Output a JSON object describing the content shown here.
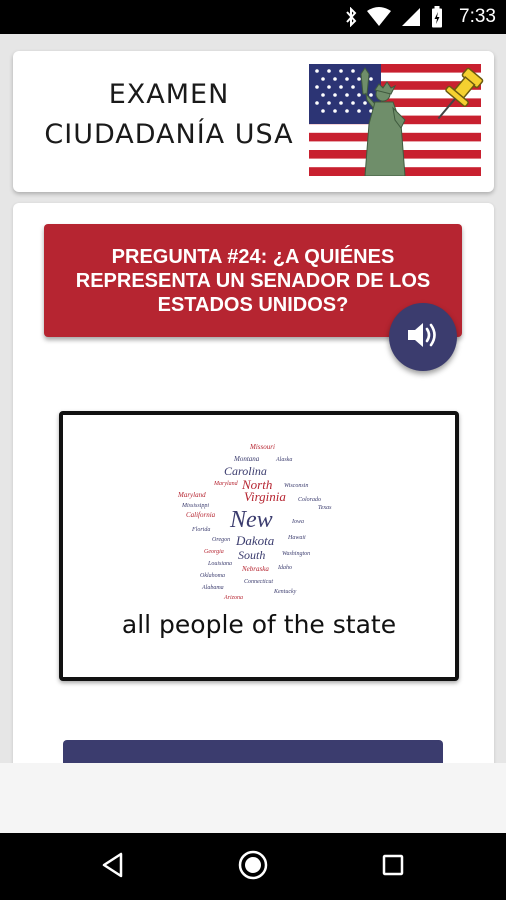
{
  "status_bar": {
    "time": "7:33",
    "icons": [
      "bluetooth-icon",
      "wifi-icon",
      "signal-icon",
      "battery-icon"
    ]
  },
  "header": {
    "title_line1": "EXAMEN",
    "title_line2": "CIUDADANÍA USA",
    "logo": "us-flag-statue-of-liberty-pin-logo"
  },
  "question": {
    "text": "PREGUNTA #24: ¿A QUIÉNES REPRESENTA UN SENADOR DE LOS ESTADOS UNIDOS?",
    "audio_icon": "speaker-icon"
  },
  "answer": {
    "image": "us-states-word-cloud",
    "text": "all people of the state"
  },
  "nav": {
    "icons": [
      "back-icon",
      "home-icon",
      "recents-icon"
    ]
  },
  "colors": {
    "question_banner": "#b62531",
    "accent_navy": "#3b3c6e",
    "status_bar": "#000000"
  }
}
